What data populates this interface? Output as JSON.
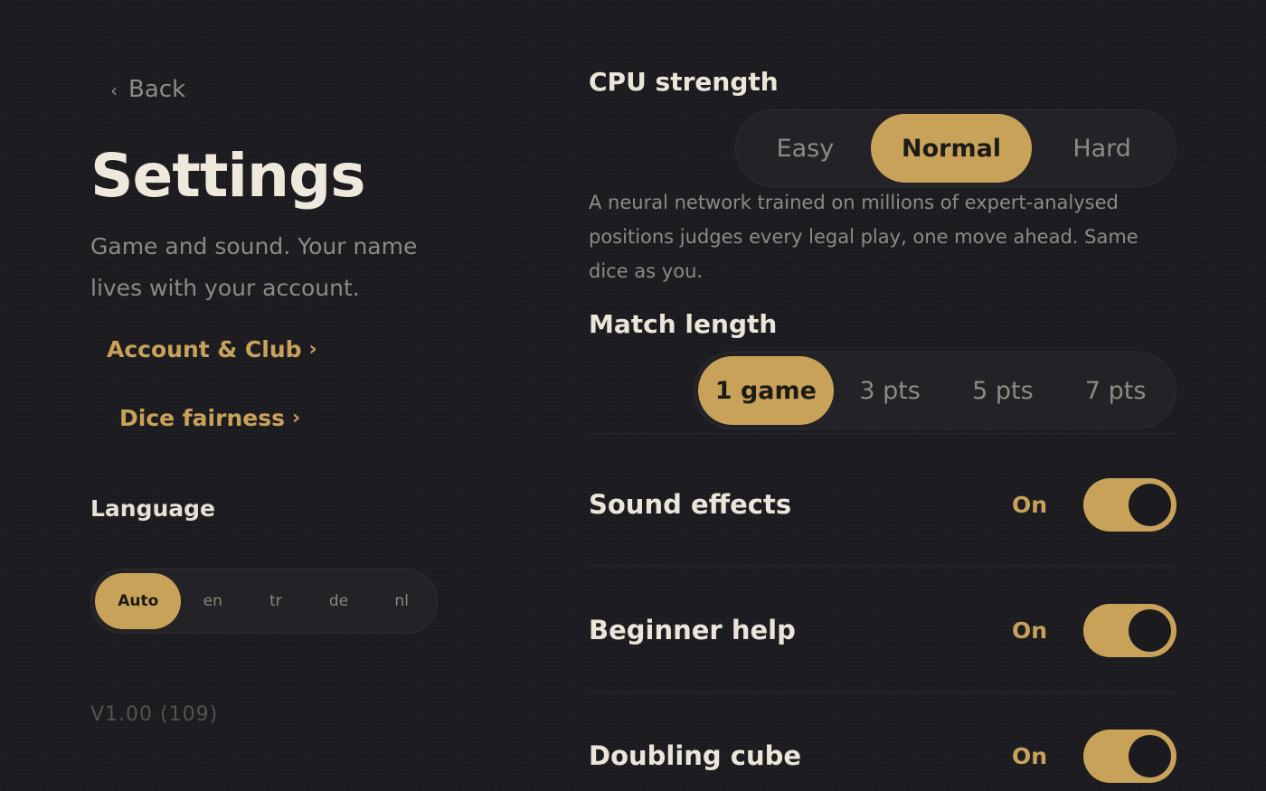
{
  "nav": {
    "back_label": "Back"
  },
  "header": {
    "title": "Settings",
    "subtitle": "Game and sound. Your name lives with your account."
  },
  "links": {
    "account": "Account & Club",
    "dice": "Dice fairness"
  },
  "language": {
    "label": "Language",
    "options": [
      "Auto",
      "en",
      "tr",
      "de",
      "nl"
    ],
    "selected": "Auto"
  },
  "version": "V1.00 (109)",
  "cpu_strength": {
    "label": "CPU strength",
    "options": [
      "Easy",
      "Normal",
      "Hard"
    ],
    "selected": "Normal",
    "description": "A neural network trained on millions of expert-analysed positions judges every legal play, one move ahead. Same dice as you."
  },
  "match_length": {
    "label": "Match length",
    "options": [
      "1 game",
      "3 pts",
      "5 pts",
      "7 pts"
    ],
    "selected": "1 game"
  },
  "toggles": [
    {
      "label": "Sound effects",
      "state": "On"
    },
    {
      "label": "Beginner help",
      "state": "On"
    },
    {
      "label": "Doubling cube",
      "state": "On"
    }
  ],
  "colors": {
    "background": "#1b1b1f",
    "accent": "#c9a25a",
    "surface": "#232327"
  }
}
